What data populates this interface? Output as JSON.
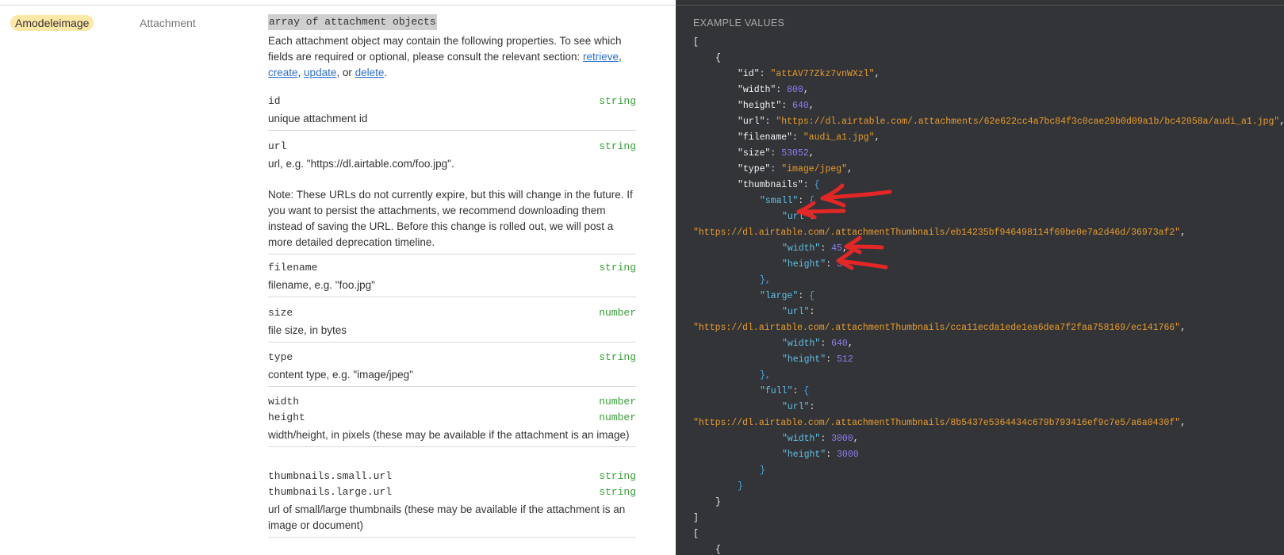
{
  "field": {
    "name": "Amodeleimage",
    "type": "Attachment"
  },
  "doc": {
    "type_title": "array of attachment objects",
    "intro_text": "Each attachment object may contain the following properties. To see which fields are required or optional, please consult the relevant section: ",
    "links": [
      "retrieve",
      "create",
      "update",
      "delete"
    ],
    "sep_comma": ", ",
    "sep_or": ", or ",
    "intro_end": ".",
    "properties": [
      {
        "names": [
          "id"
        ],
        "types": [
          "string"
        ],
        "desc": "unique attachment id"
      },
      {
        "names": [
          "url"
        ],
        "types": [
          "string"
        ],
        "desc": "url, e.g. \"https://dl.airtable.com/foo.jpg\".",
        "note": "Note: These URLs do not currently expire, but this will change in the future. If you want to persist the attachments, we recommend downloading them instead of saving the URL. Before this change is rolled out, we will post a more detailed deprecation timeline."
      },
      {
        "names": [
          "filename"
        ],
        "types": [
          "string"
        ],
        "desc": "filename, e.g. \"foo.jpg\""
      },
      {
        "names": [
          "size"
        ],
        "types": [
          "number"
        ],
        "desc": "file size, in bytes"
      },
      {
        "names": [
          "type"
        ],
        "types": [
          "string"
        ],
        "desc": "content type, e.g. \"image/jpeg\""
      },
      {
        "names": [
          "width",
          "height"
        ],
        "types": [
          "number",
          "number"
        ],
        "desc": "width/height, in pixels (these may be available if the attachment is an image)"
      },
      {
        "names": [
          "thumbnails.small.url",
          "thumbnails.large.url"
        ],
        "types": [
          "string",
          "string"
        ],
        "desc": "url of small/large thumbnails (these may be available if the attachment is an image or document)"
      }
    ]
  },
  "example": {
    "title": "EXAMPLE VALUES",
    "lines": [
      {
        "ind": 0,
        "parts": [
          [
            "p",
            "["
          ]
        ]
      },
      {
        "ind": 1,
        "parts": [
          [
            "p",
            "{"
          ]
        ]
      },
      {
        "ind": 2,
        "parts": [
          [
            "kq",
            "\""
          ],
          [
            "k",
            "id"
          ],
          [
            "kq",
            "\": "
          ],
          [
            "s",
            "\"attAV77Zkz7vnWXzl\""
          ],
          [
            "p",
            ","
          ]
        ]
      },
      {
        "ind": 2,
        "parts": [
          [
            "kq",
            "\""
          ],
          [
            "k",
            "width"
          ],
          [
            "kq",
            "\": "
          ],
          [
            "n",
            "800"
          ],
          [
            "p",
            ","
          ]
        ]
      },
      {
        "ind": 2,
        "parts": [
          [
            "kq",
            "\""
          ],
          [
            "k",
            "height"
          ],
          [
            "kq",
            "\": "
          ],
          [
            "n",
            "640"
          ],
          [
            "p",
            ","
          ]
        ]
      },
      {
        "ind": 2,
        "parts": [
          [
            "kq",
            "\""
          ],
          [
            "k",
            "url"
          ],
          [
            "kq",
            "\": "
          ],
          [
            "s",
            "\"https://dl.airtable.com/.attachments/62e622cc4a7bc84f3c0cae29b0d09a1b/bc42058a/audi_a1.jpg\""
          ],
          [
            "p",
            ","
          ]
        ]
      },
      {
        "ind": 2,
        "parts": [
          [
            "kq",
            "\""
          ],
          [
            "k",
            "filename"
          ],
          [
            "kq",
            "\": "
          ],
          [
            "s",
            "\"audi_a1.jpg\""
          ],
          [
            "p",
            ","
          ]
        ]
      },
      {
        "ind": 2,
        "parts": [
          [
            "kq",
            "\""
          ],
          [
            "k",
            "size"
          ],
          [
            "kq",
            "\": "
          ],
          [
            "n",
            "53052"
          ],
          [
            "p",
            ","
          ]
        ]
      },
      {
        "ind": 2,
        "parts": [
          [
            "kq",
            "\""
          ],
          [
            "k",
            "type"
          ],
          [
            "kq",
            "\": "
          ],
          [
            "s",
            "\"image/jpeg\""
          ],
          [
            "p",
            ","
          ]
        ]
      },
      {
        "ind": 2,
        "parts": [
          [
            "kq",
            "\""
          ],
          [
            "k",
            "thumbnails"
          ],
          [
            "kq",
            "\": "
          ],
          [
            "p2",
            "{"
          ]
        ]
      },
      {
        "ind": 3,
        "parts": [
          [
            "k2",
            "\"small\""
          ],
          [
            "p",
            ": "
          ],
          [
            "p2",
            "{"
          ]
        ]
      },
      {
        "ind": 4,
        "parts": [
          [
            "k2",
            "\"url\""
          ],
          [
            "p",
            ":"
          ]
        ]
      },
      {
        "ind": 0,
        "parts": [
          [
            "s",
            "\"https://dl.airtable.com/.attachmentThumbnails/eb14235bf946498114f69be0e7a2d46d/36973af2\""
          ],
          [
            "p",
            ","
          ]
        ]
      },
      {
        "ind": 4,
        "parts": [
          [
            "k2",
            "\"width\""
          ],
          [
            "p",
            ": "
          ],
          [
            "n",
            "45"
          ],
          [
            "p",
            ","
          ]
        ]
      },
      {
        "ind": 4,
        "parts": [
          [
            "k2",
            "\"height\""
          ],
          [
            "p",
            ": "
          ],
          [
            "n",
            "36"
          ]
        ]
      },
      {
        "ind": 3,
        "parts": [
          [
            "p2",
            "},"
          ]
        ]
      },
      {
        "ind": 3,
        "parts": [
          [
            "k2",
            "\"large\""
          ],
          [
            "p",
            ": "
          ],
          [
            "p2",
            "{"
          ]
        ]
      },
      {
        "ind": 4,
        "parts": [
          [
            "k2",
            "\"url\""
          ],
          [
            "p",
            ":"
          ]
        ]
      },
      {
        "ind": 0,
        "parts": [
          [
            "s",
            "\"https://dl.airtable.com/.attachmentThumbnails/cca11ecda1ede1ea6dea7f2faa758169/ec141766\""
          ],
          [
            "p",
            ","
          ]
        ]
      },
      {
        "ind": 4,
        "parts": [
          [
            "k2",
            "\"width\""
          ],
          [
            "p",
            ": "
          ],
          [
            "n",
            "640"
          ],
          [
            "p",
            ","
          ]
        ]
      },
      {
        "ind": 4,
        "parts": [
          [
            "k2",
            "\"height\""
          ],
          [
            "p",
            ": "
          ],
          [
            "n",
            "512"
          ]
        ]
      },
      {
        "ind": 3,
        "parts": [
          [
            "p2",
            "},"
          ]
        ]
      },
      {
        "ind": 3,
        "parts": [
          [
            "k2",
            "\"full\""
          ],
          [
            "p",
            ": "
          ],
          [
            "p2",
            "{"
          ]
        ]
      },
      {
        "ind": 4,
        "parts": [
          [
            "k2",
            "\"url\""
          ],
          [
            "p",
            ":"
          ]
        ]
      },
      {
        "ind": 0,
        "parts": [
          [
            "s",
            "\"https://dl.airtable.com/.attachmentThumbnails/8b5437e5364434c679b793416ef9c7e5/a6a0430f\""
          ],
          [
            "p",
            ","
          ]
        ]
      },
      {
        "ind": 4,
        "parts": [
          [
            "k2",
            "\"width\""
          ],
          [
            "p",
            ": "
          ],
          [
            "n",
            "3000"
          ],
          [
            "p",
            ","
          ]
        ]
      },
      {
        "ind": 4,
        "parts": [
          [
            "k2",
            "\"height\""
          ],
          [
            "p",
            ": "
          ],
          [
            "n",
            "3000"
          ]
        ]
      },
      {
        "ind": 3,
        "parts": [
          [
            "p2",
            "}"
          ]
        ]
      },
      {
        "ind": 2,
        "parts": [
          [
            "p2",
            "}"
          ]
        ]
      },
      {
        "ind": 1,
        "parts": [
          [
            "p",
            "}"
          ]
        ]
      },
      {
        "ind": 0,
        "parts": [
          [
            "p",
            "]"
          ]
        ]
      },
      {
        "ind": 0,
        "parts": [
          [
            "p",
            "["
          ]
        ]
      },
      {
        "ind": 1,
        "parts": [
          [
            "p",
            "{"
          ]
        ]
      }
    ]
  },
  "annotation": {
    "color": "#e32626"
  }
}
